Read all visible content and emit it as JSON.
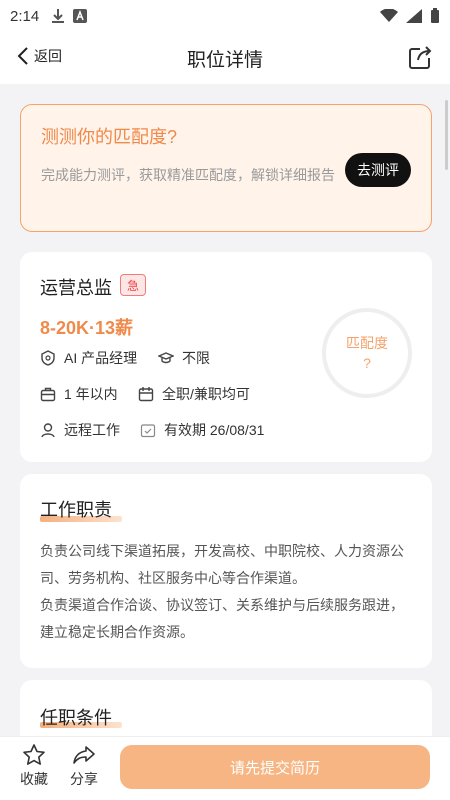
{
  "status": {
    "time": "2:14"
  },
  "header": {
    "back_label": "返回",
    "title": "职位详情"
  },
  "match": {
    "title": "测测你的匹配度?",
    "desc": "完成能力测评，获取精准匹配度，解锁详细报告",
    "button": "去测评"
  },
  "job": {
    "name": "运营总监",
    "urgent": "急",
    "salary": "8-20K·13薪",
    "category": "AI 产品经理",
    "education": "不限",
    "experience": "1 年以内",
    "type": "全职/兼职均可",
    "location": "远程工作",
    "validity": "有效期 26/08/31",
    "match_label": "匹配度",
    "match_value": "?"
  },
  "duties": {
    "title": "工作职责",
    "text": "负责公司线下渠道拓展，开发高校、中职院校、人力资源公司、劳务机构、社区服务中心等合作渠道。\n负责渠道合作洽谈、协议签订、关系维护与后续服务跟进，建立稳定长期合作资源。"
  },
  "requirements": {
    "title": "任职条件"
  },
  "bottom": {
    "favorite": "收藏",
    "share": "分享",
    "submit": "请先提交简历"
  },
  "colors": {
    "accent": "#f08a4b",
    "submit_bg": "#f6b583"
  }
}
